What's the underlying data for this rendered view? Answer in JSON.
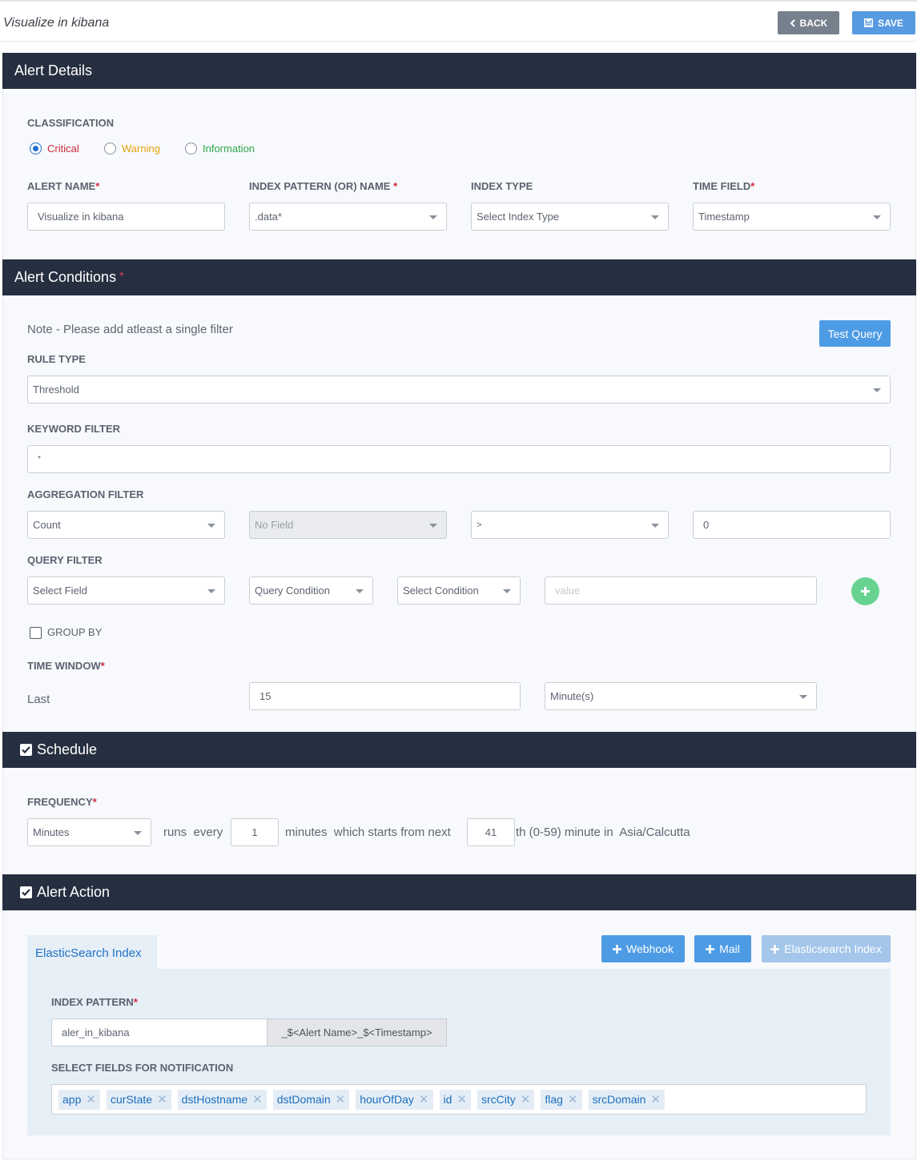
{
  "header": {
    "title": "Visualize in kibana",
    "back_label": "BACK",
    "save_label": "SAVE"
  },
  "alert_details": {
    "section_title": "Alert Details",
    "classification_label": "CLASSIFICATION",
    "classifications": [
      {
        "label": "Critical",
        "color": "#d0263a",
        "selected": true
      },
      {
        "label": "Warning",
        "color": "#e8a20c",
        "selected": false
      },
      {
        "label": "Information",
        "color": "#2ea84a",
        "selected": false
      }
    ],
    "alert_name_label": "ALERT NAME",
    "alert_name_value": "Visualize in kibana",
    "index_pattern_label": "INDEX PATTERN (OR) NAME",
    "index_pattern_value": ".data*",
    "index_type_label": "INDEX TYPE",
    "index_type_value": "Select Index Type",
    "time_field_label": "TIME FIELD",
    "time_field_value": "Timestamp",
    "required_mark": "*"
  },
  "alert_conditions": {
    "section_title": "Alert Conditions",
    "note": "Note - Please add atleast a single filter",
    "test_query_label": "Test Query",
    "rule_type_label": "RULE TYPE",
    "rule_type_value": "Threshold",
    "keyword_filter_label": "KEYWORD FILTER",
    "keyword_filter_value": "*",
    "aggregation_filter_label": "AGGREGATION FILTER",
    "aggregation": {
      "function": "Count",
      "field": "No Field",
      "operator": ">",
      "value": "0"
    },
    "query_filter_label": "QUERY FILTER",
    "query_filter": {
      "field": "Select Field",
      "query_condition": "Query Condition",
      "condition": "Select Condition",
      "value_placeholder": "value"
    },
    "group_by_label": "GROUP BY",
    "time_window_label": "TIME WINDOW",
    "last_label": "Last",
    "time_window_value": "15",
    "time_window_unit": "Minute(s)"
  },
  "schedule": {
    "section_title": "Schedule",
    "frequency_label": "FREQUENCY",
    "frequency_value": "Minutes",
    "runs_every_text": "runs  every",
    "every_value": "1",
    "minutes_text": "minutes  which starts from next",
    "start_minute": "41",
    "suffix_text": "th (0-59) minute in  Asia/Calcutta"
  },
  "alert_action": {
    "section_title": "Alert Action",
    "active_tab": "ElasticSearch Index",
    "webhook_label": "Webhook",
    "mail_label": "Mail",
    "es_index_label": "Elasticsearch Index",
    "index_pattern_label": "INDEX PATTERN",
    "index_pattern_value": "aler_in_kibana",
    "index_pattern_suffix": "_$<Alert Name>_$<Timestamp>",
    "select_fields_label": "SELECT FIELDS FOR NOTIFICATION",
    "fields": [
      "app",
      "curState",
      "dstHostname",
      "dstDomain",
      "hourOfDay",
      "id",
      "srcCity",
      "flag",
      "srcDomain"
    ]
  }
}
